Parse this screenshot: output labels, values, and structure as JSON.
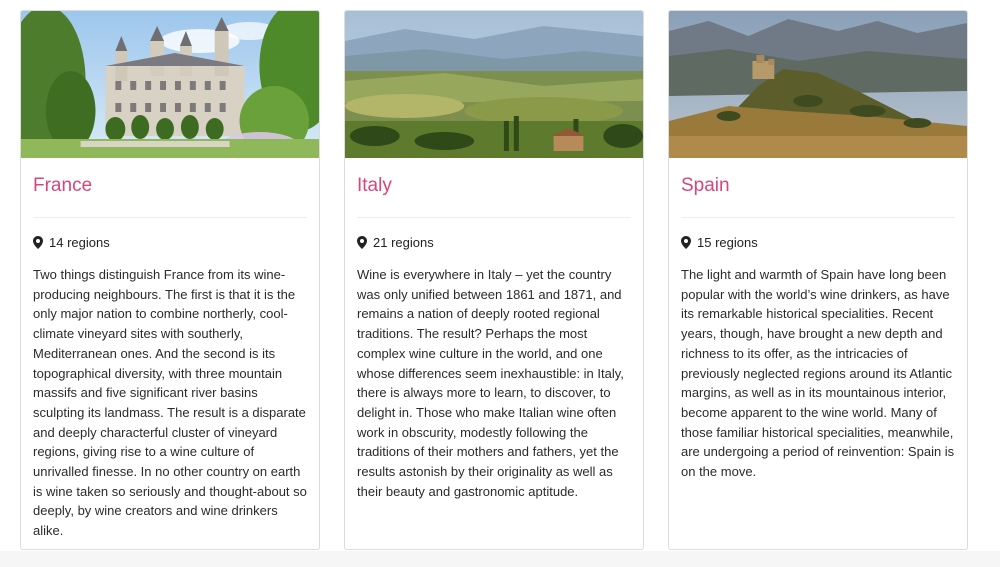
{
  "cards": [
    {
      "title": "France",
      "regions": "14 regions",
      "description": "Two things distinguish France from its wine-producing neighbours. The first is that it is the only major nation to combine northerly, cool-climate vineyard sites with southerly, Mediterranean ones. And the second is its topographical diversity, with three mountain massifs and five significant river basins sculpting its landmass. The result is a disparate and deeply characterful cluster of vineyard regions, giving rise to a wine culture of unrivalled finesse. In no other country on earth is wine taken so seriously and thought-about so deeply, by wine creators and wine drinkers alike."
    },
    {
      "title": "Italy",
      "regions": "21 regions",
      "description": "Wine is everywhere in Italy – yet the country was only unified between 1861 and 1871, and remains a nation of deeply rooted regional traditions. The result? Perhaps the most complex wine culture in the world, and one whose differences seem inexhaustible: in Italy, there is always more to learn, to discover, to delight in. Those who make Italian wine often work in obscurity, modestly following the traditions of their mothers and fathers, yet the results astonish by their originality as well as their beauty and gastronomic aptitude."
    },
    {
      "title": "Spain",
      "regions": "15 regions",
      "description": "The light and warmth of Spain have long been popular with the world’s wine drinkers, as have its remarkable historical specialities. Recent years, though, have brought a new depth and richness to its offer, as the intricacies of previously neglected regions around its Atlantic margins, as well as in its mountainous interior, become apparent to the wine world. Many of those familiar historical specialities, meanwhile, are undergoing a period of reinvention: Spain is on the move."
    }
  ],
  "colors": {
    "title": "#d6457b",
    "border": "#dcdcdc",
    "text": "#2b2b2b"
  },
  "icons": {
    "regions": "map-marker-icon"
  }
}
